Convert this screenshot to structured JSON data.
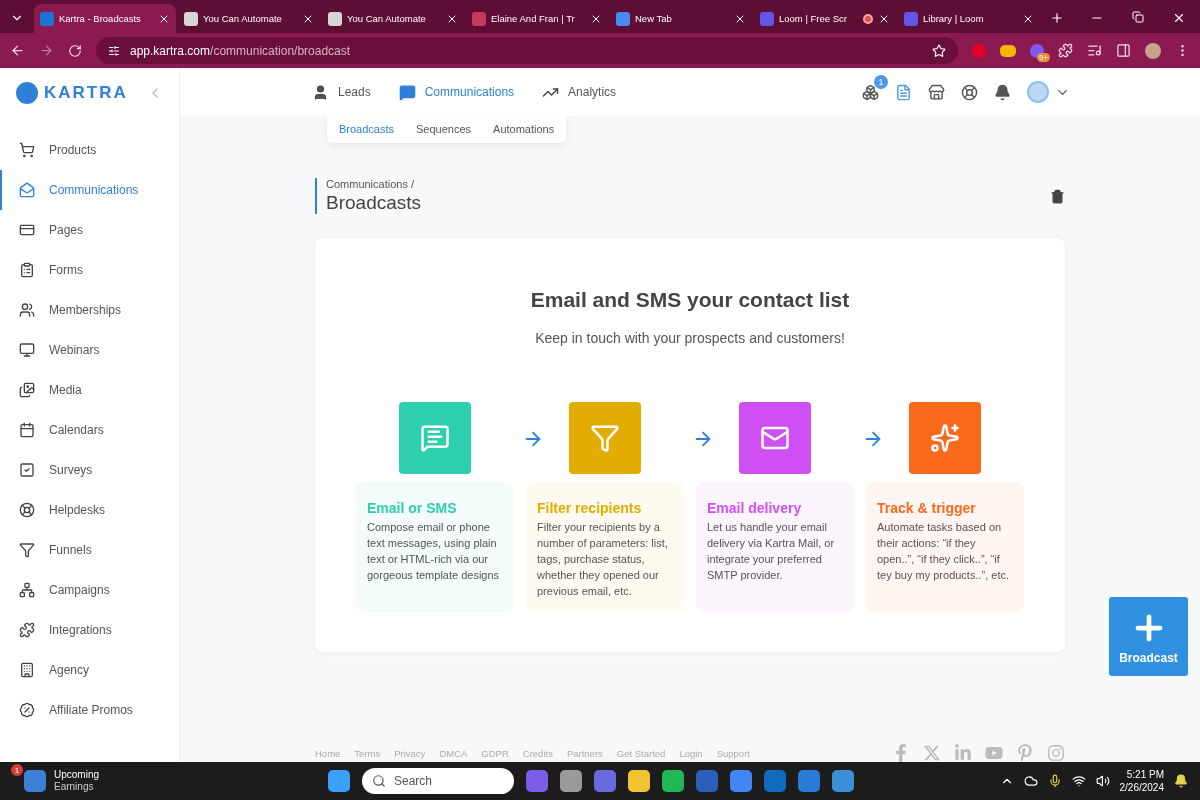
{
  "browser": {
    "tabs": [
      {
        "title": "Kartra - Broadcasts",
        "selected": true,
        "recording": false
      },
      {
        "title": "You Can Automate",
        "selected": false,
        "recording": false
      },
      {
        "title": "You Can Automate",
        "selected": false,
        "recording": false
      },
      {
        "title": "Elaine And Fran | Tr",
        "selected": false,
        "recording": false
      },
      {
        "title": "New Tab",
        "selected": false,
        "recording": false
      },
      {
        "title": "Loom | Free Scr",
        "selected": false,
        "recording": true
      },
      {
        "title": "Library | Loom",
        "selected": false,
        "recording": false
      }
    ],
    "address": {
      "host": "app.kartra.com",
      "path": "/communication/broadcast"
    },
    "extension_badge": "9+"
  },
  "sidebar": {
    "logo": "KARTRA",
    "items": [
      {
        "label": "Products",
        "selected": false
      },
      {
        "label": "Communications",
        "selected": true
      },
      {
        "label": "Pages",
        "selected": false
      },
      {
        "label": "Forms",
        "selected": false
      },
      {
        "label": "Memberships",
        "selected": false
      },
      {
        "label": "Webinars",
        "selected": false
      },
      {
        "label": "Media",
        "selected": false
      },
      {
        "label": "Calendars",
        "selected": false
      },
      {
        "label": "Surveys",
        "selected": false
      },
      {
        "label": "Helpdesks",
        "selected": false
      },
      {
        "label": "Funnels",
        "selected": false
      },
      {
        "label": "Campaigns",
        "selected": false
      },
      {
        "label": "Integrations",
        "selected": false
      },
      {
        "label": "Agency",
        "selected": false
      },
      {
        "label": "Affiliate Promos",
        "selected": false
      }
    ]
  },
  "top_nav": {
    "items": [
      {
        "label": "Leads",
        "selected": false
      },
      {
        "label": "Communications",
        "selected": true
      },
      {
        "label": "Analytics",
        "selected": false
      }
    ],
    "sub_items": [
      {
        "label": "Broadcasts",
        "selected": true
      },
      {
        "label": "Sequences",
        "selected": false
      },
      {
        "label": "Automations",
        "selected": false
      }
    ],
    "notification_badge": "1"
  },
  "breadcrumb": {
    "parent": "Communications /",
    "title": "Broadcasts"
  },
  "intro": {
    "heading": "Email and SMS your contact list",
    "subheading": "Keep in touch with your prospects and customers!",
    "steps": [
      {
        "title": "Email or SMS",
        "text": "Compose email or phone text messages, using plain text or HTML-rich via our gorgeous template designs",
        "color": "#2ecfae"
      },
      {
        "title": "Filter recipients",
        "text": "Filter your recipients by a number of parameters: list, tags, purchase status, whether they opened our previous email, etc.",
        "color": "#e2ad00"
      },
      {
        "title": "Email delivery",
        "text": "Let us handle your email delivery via Kartra Mail, or integrate your preferred SMTP provider.",
        "color": "#d04ff2"
      },
      {
        "title": "Track & trigger",
        "text": "Automate tasks based on their actions: “if they open..”, “if they click..”, “if tey buy my products..”, etc.",
        "color": "#fa6a1c"
      }
    ]
  },
  "new_button": {
    "label": "Broadcast"
  },
  "footer": {
    "links": [
      "Home",
      "Terms",
      "Privacy",
      "DMCA",
      "GDPR",
      "Credits",
      "Partners",
      "Get Started",
      "Login",
      "Support"
    ]
  },
  "taskbar": {
    "widget": {
      "title": "Upcoming",
      "subtitle": "Earnings",
      "badge": "1"
    },
    "search": {
      "placeholder": "Search"
    },
    "time": "5:21 PM",
    "date": "2/26/2024"
  }
}
